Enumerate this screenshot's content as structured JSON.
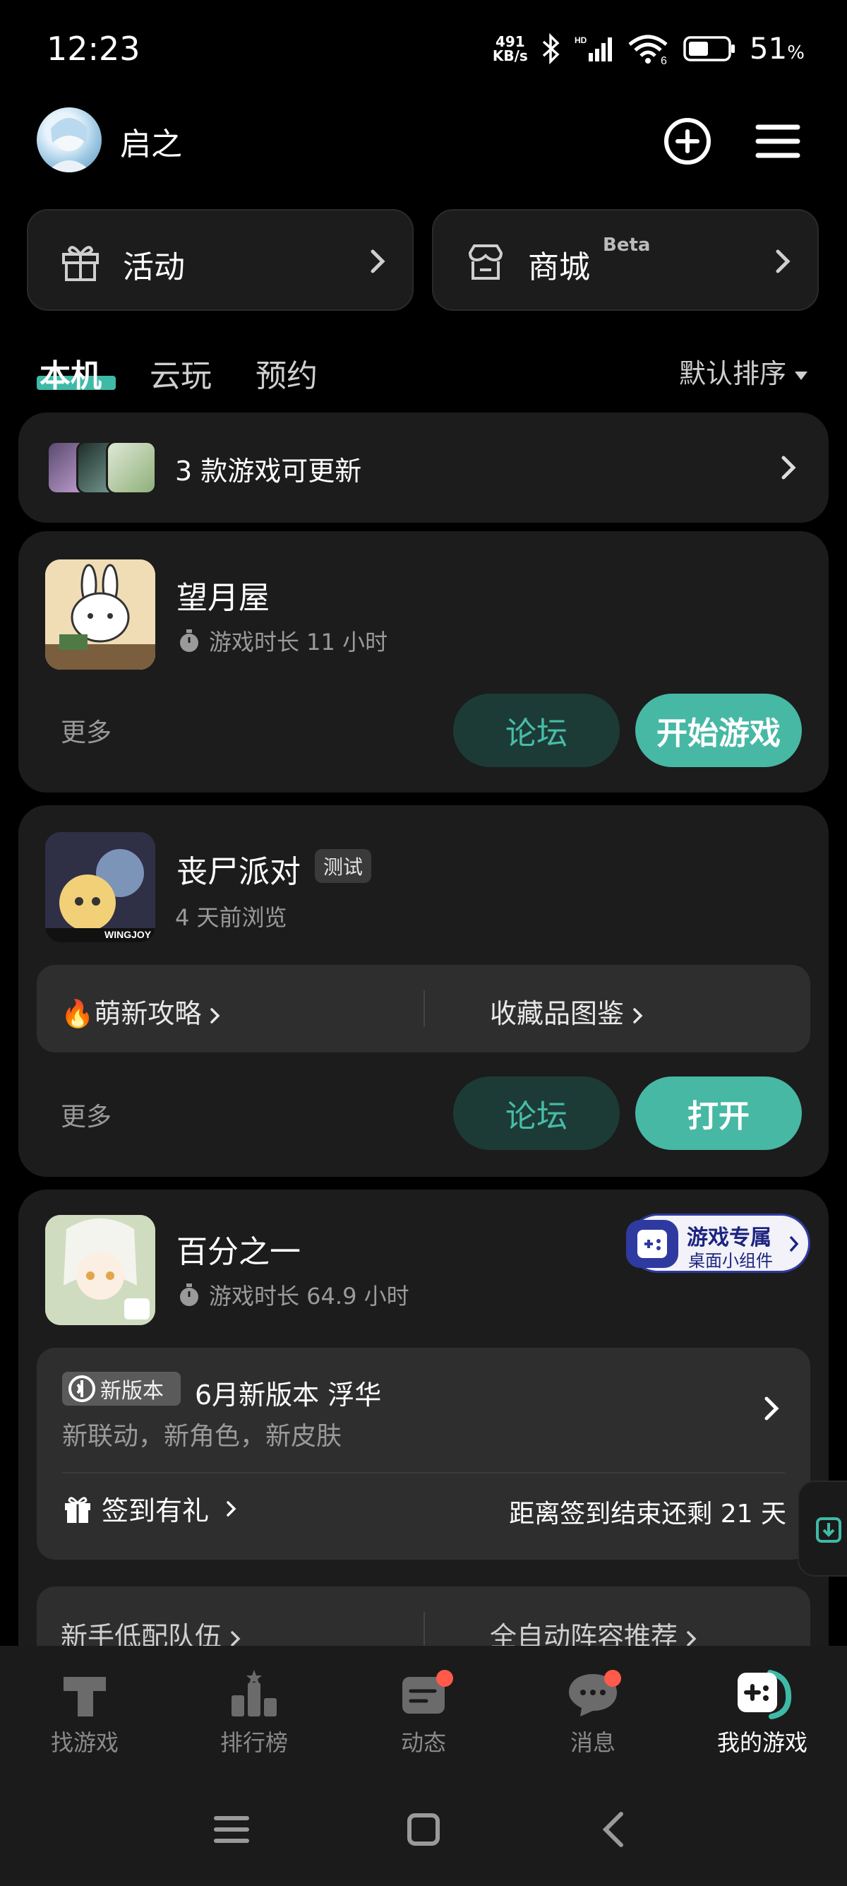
{
  "status": {
    "time": "12:23",
    "net_speed_value": "491",
    "net_speed_unit": "KB/s",
    "battery_value": "51",
    "battery_unit": "%"
  },
  "header": {
    "username": "启之"
  },
  "quick": {
    "activity": "活动",
    "store": "商城",
    "store_beta": "Beta"
  },
  "tabs": {
    "local": "本机",
    "cloud": "云玩",
    "reserve": "预约",
    "sort": "默认排序"
  },
  "update_banner": {
    "text": "3 款游戏可更新"
  },
  "games": [
    {
      "name": "望月屋",
      "meta": "游戏时长 11 小时",
      "more": "更多",
      "forum": "论坛",
      "primary": "开始游戏"
    },
    {
      "name": "丧尸派对",
      "badge": "测试",
      "meta": "4 天前浏览",
      "link1": "萌新攻略",
      "link2": "收藏品图鉴",
      "more": "更多",
      "forum": "论坛",
      "primary": "打开"
    },
    {
      "name": "百分之一",
      "meta": "游戏时长 64.9 小时",
      "widget_title": "游戏专属",
      "widget_sub": "桌面小组件",
      "version_badge": "新版本",
      "version_title": "6月新版本 浮华",
      "version_sub": "新联动，新角色，新皮肤",
      "checkin": "签到有礼",
      "checkin_remain": "距离签到结束还剩 21 天",
      "link1": "新手低配队伍",
      "link2": "全自动阵容推荐"
    }
  ],
  "nav": {
    "find": "找游戏",
    "rank": "排行榜",
    "feed": "动态",
    "msg": "消息",
    "mine": "我的游戏"
  }
}
